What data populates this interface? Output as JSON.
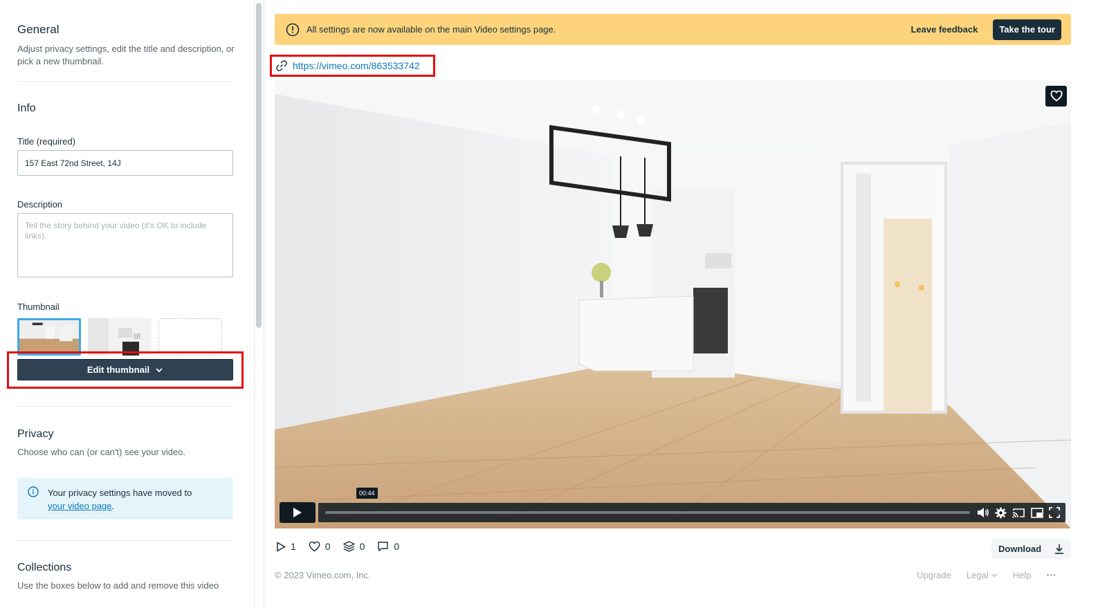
{
  "sidebar": {
    "general": {
      "title": "General",
      "description": "Adjust privacy settings, edit the title and description, or pick a new thumbnail."
    },
    "info": {
      "title": "Info",
      "title_label": "Title (required)",
      "title_value": "157 East 72nd Street, 14J",
      "description_label": "Description",
      "description_placeholder": "Tell the story behind your video (it's OK to include links).",
      "thumbnail_label": "Thumbnail",
      "edit_thumbnail": "Edit thumbnail"
    },
    "privacy": {
      "title": "Privacy",
      "description": "Choose who can (or can't) see your video.",
      "notice_text": "Your privacy settings have moved to",
      "notice_link": "your video page",
      "notice_end": "."
    },
    "collections": {
      "title": "Collections",
      "description": "Use the boxes below to add and remove this video"
    }
  },
  "banner": {
    "text": "All settings are now available on the main Video settings page.",
    "feedback": "Leave feedback",
    "tour": "Take the tour",
    "color": "#fdd47c"
  },
  "video": {
    "url": "https://vimeo.com/863533742",
    "time_tooltip": "00:44"
  },
  "stats": {
    "plays": "1",
    "likes": "0",
    "collections": "0",
    "comments": "0"
  },
  "download_label": "Download",
  "footer": {
    "copyright": "© 2023 Vimeo.com, Inc.",
    "upgrade": "Upgrade",
    "legal": "Legal",
    "help": "Help",
    "more": "•••"
  }
}
